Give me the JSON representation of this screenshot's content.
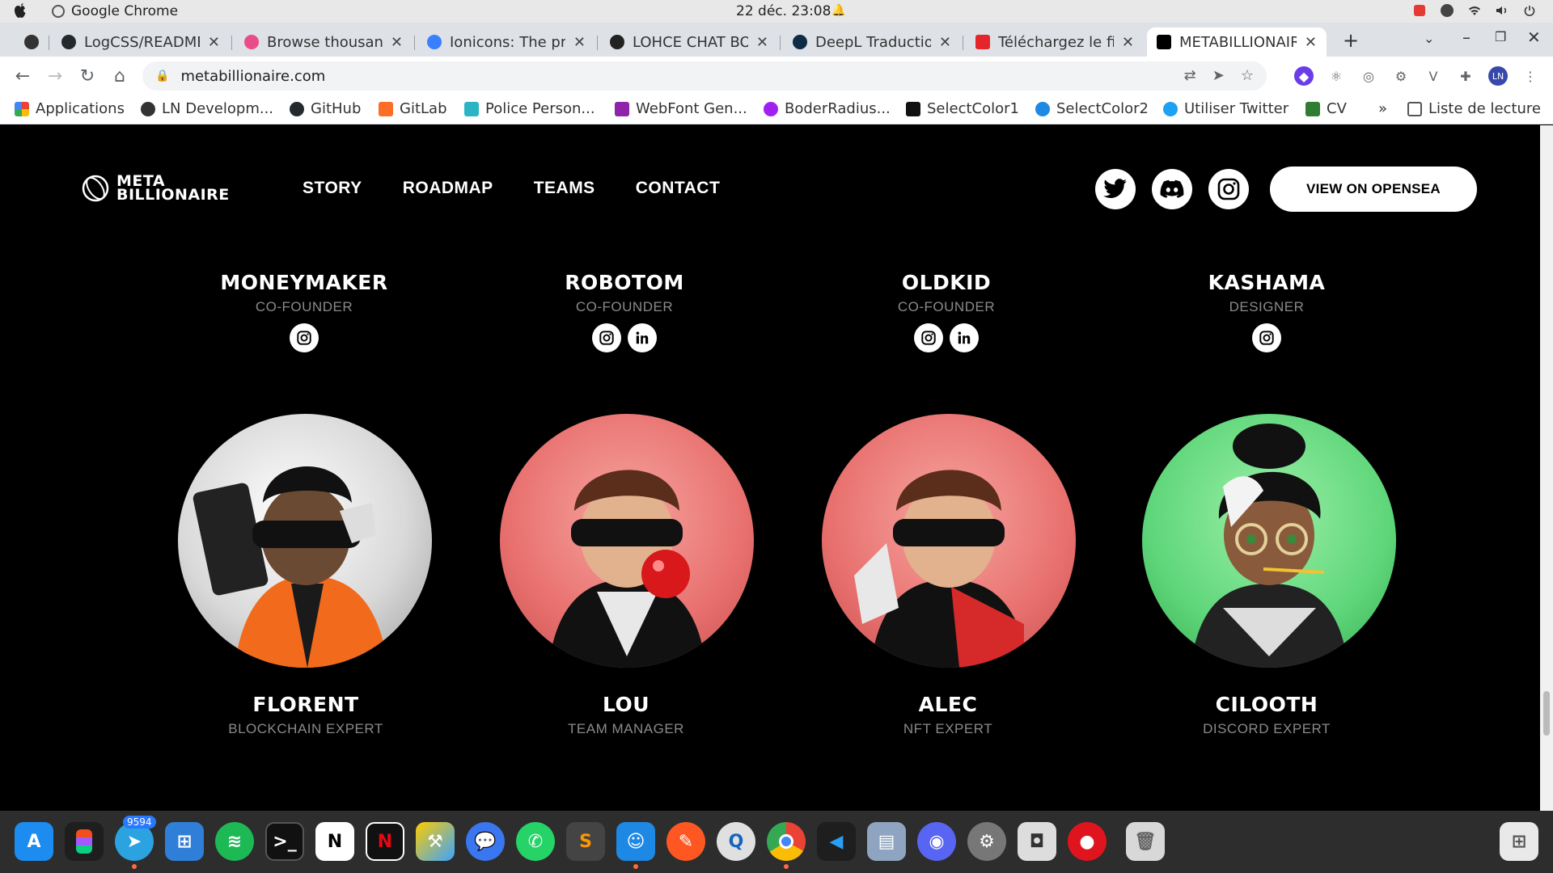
{
  "os": {
    "app_name": "Google Chrome",
    "datetime": "22 déc.  23:08"
  },
  "tabs": [
    {
      "title": "",
      "color": "#333333"
    },
    {
      "title": "LogCSS/README",
      "color": "#24292e"
    },
    {
      "title": "Browse thousand",
      "color": "#ea4c89"
    },
    {
      "title": "Ionicons: The pre",
      "color": "#3880ff"
    },
    {
      "title": "LOHCE CHAT BOT",
      "color": "#222222"
    },
    {
      "title": "DeepL Traduction",
      "color": "#0f2b46"
    },
    {
      "title": "Téléchargez le fic",
      "color": "#e4262c"
    },
    {
      "title": "METABILLIONAIRE",
      "color": "#000000"
    }
  ],
  "toolbar": {
    "url": "metabillionaire.com"
  },
  "bookmarks": [
    {
      "label": "Applications",
      "color": "#ea4335"
    },
    {
      "label": "LN Developm...",
      "color": "#333333"
    },
    {
      "label": "GitHub",
      "color": "#24292e"
    },
    {
      "label": "GitLab",
      "color": "#fc6d26"
    },
    {
      "label": "Police Person...",
      "color": "#2bb5c4"
    },
    {
      "label": "WebFont Gen...",
      "color": "#8e24aa"
    },
    {
      "label": "BoderRadius...",
      "color": "#a020f0"
    },
    {
      "label": "SelectColor1",
      "color": "#111111"
    },
    {
      "label": "SelectColor2",
      "color": "#1e88e5"
    },
    {
      "label": "Utiliser Twitter",
      "color": "#1da1f2"
    },
    {
      "label": "CV",
      "color": "#2e7d32"
    }
  ],
  "bookmarks_more": "»",
  "reading_list": "Liste de lecture",
  "site": {
    "logo_line1": "META",
    "logo_line2": "BILLIONAIRE",
    "nav": [
      "STORY",
      "ROADMAP",
      "TEAMS",
      "CONTACT"
    ],
    "cta": "VIEW ON OPENSEA"
  },
  "team_top": [
    {
      "name": "MONEYMAKER",
      "role": "CO-FOUNDER",
      "links": [
        "instagram"
      ]
    },
    {
      "name": "ROBOTOM",
      "role": "CO-FOUNDER",
      "links": [
        "instagram",
        "linkedin"
      ]
    },
    {
      "name": "OLDKID",
      "role": "CO-FOUNDER",
      "links": [
        "instagram",
        "linkedin"
      ]
    },
    {
      "name": "KASHAMA",
      "role": "DESIGNER",
      "links": [
        "instagram"
      ]
    }
  ],
  "team_bottom": [
    {
      "name": "FLORENT",
      "role": "BLOCKCHAIN EXPERT",
      "bg": "#d9d9d9"
    },
    {
      "name": "LOU",
      "role": "TEAM MANAGER",
      "bg": "#e8706e"
    },
    {
      "name": "ALEC",
      "role": "NFT EXPERT",
      "bg": "#e8706e"
    },
    {
      "name": "CILOOTH",
      "role": "DISCORD EXPERT",
      "bg": "#5fd67a"
    }
  ],
  "dock": {
    "telegram_badge": "9594"
  }
}
